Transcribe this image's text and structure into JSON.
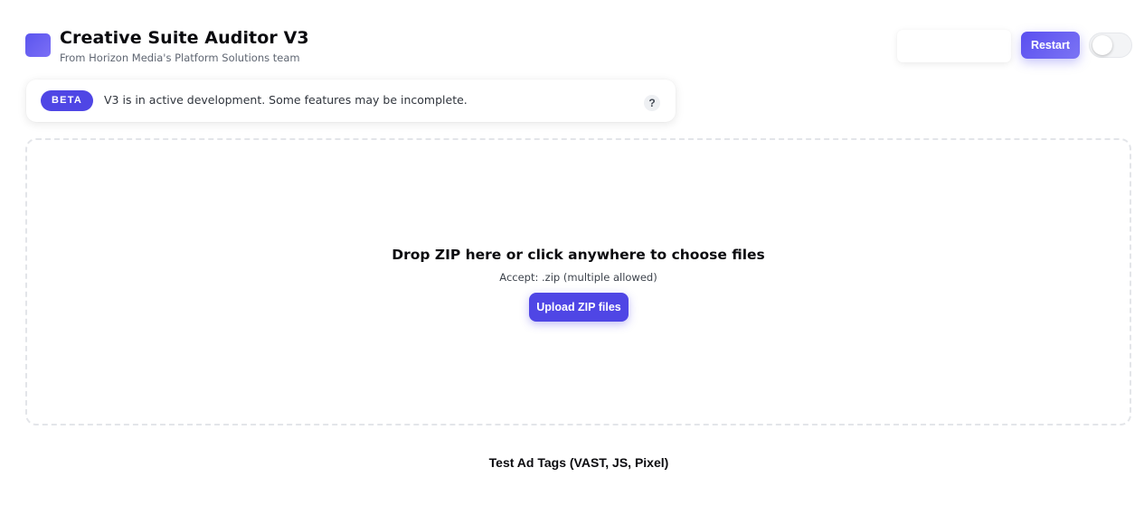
{
  "header": {
    "title": "Creative Suite Auditor V3",
    "subtitle": "From Horizon Media's Platform Solutions team",
    "logo_icon": "app-logo-square",
    "restart_label": "Restart",
    "theme_toggle": {
      "state": "off"
    }
  },
  "banner": {
    "badge": "BETA",
    "message": "V3 is in active development. Some features may be incomplete.",
    "help_label": "?"
  },
  "dropzone": {
    "title": "Drop ZIP here or click anywhere to choose files",
    "accept": "Accept: .zip (multiple allowed)",
    "upload_label": "Upload ZIP files"
  },
  "test_tags": {
    "title": "Test Ad Tags (VAST, JS, Pixel)"
  },
  "colors": {
    "accent": "#4f46e5",
    "accent_light": "#7b74f4",
    "dropzone_border": "#e3e5e9"
  }
}
